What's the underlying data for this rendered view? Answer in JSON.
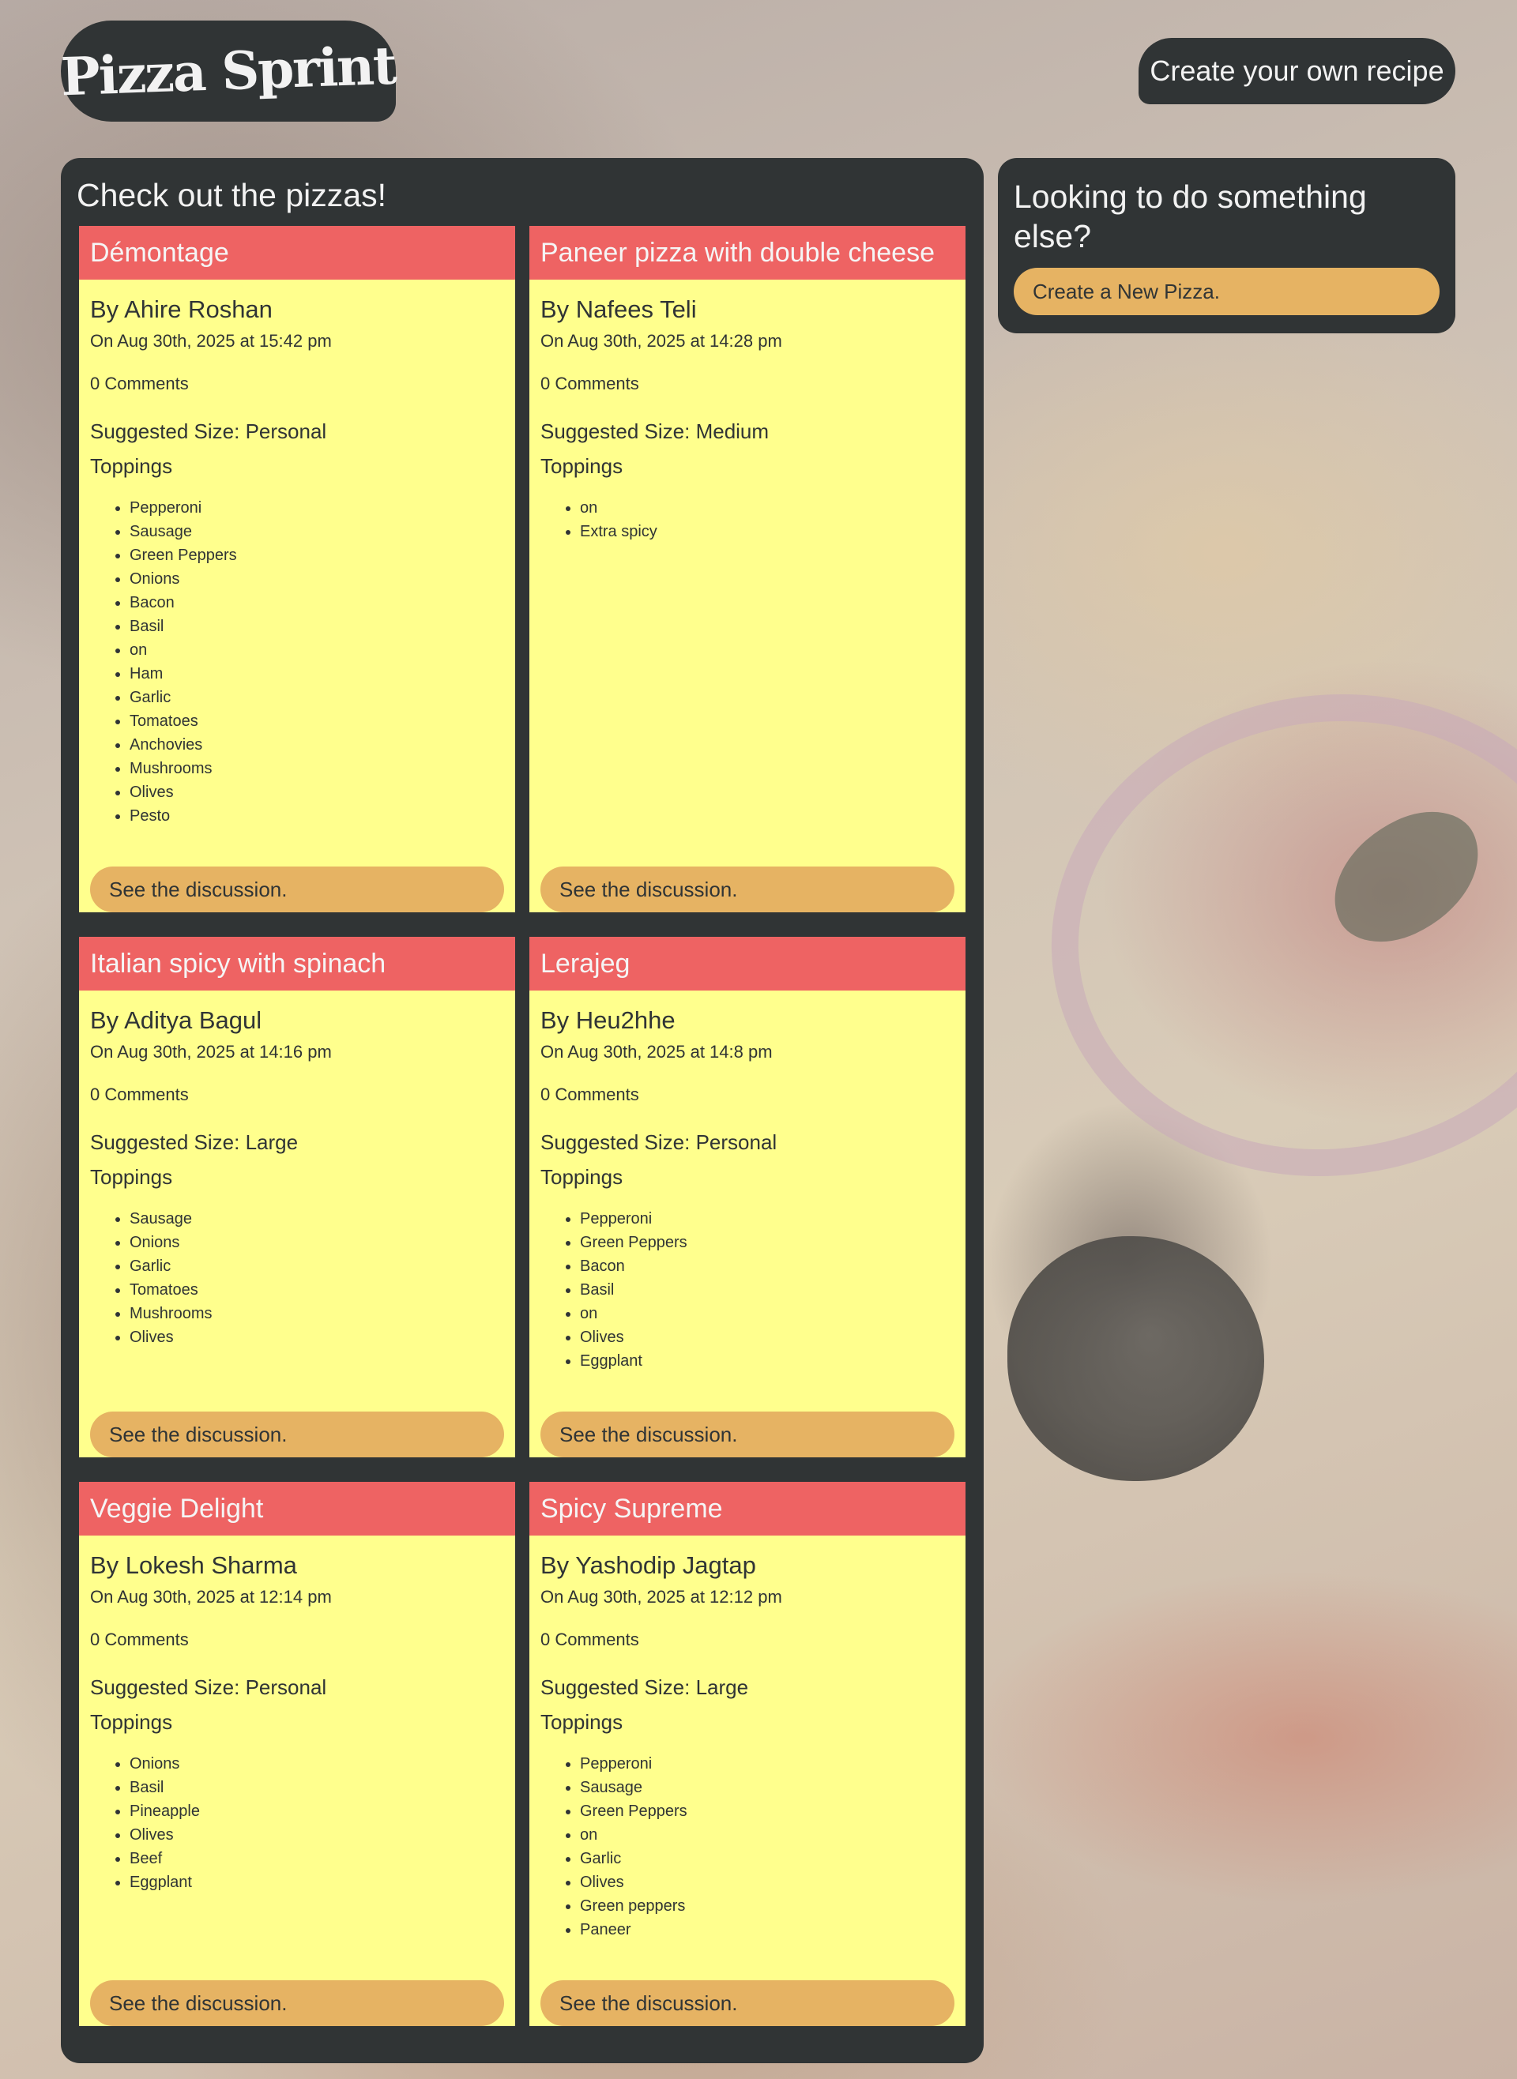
{
  "header": {
    "logo_text": "Pizza Sprint",
    "create_recipe_label": "Create your own recipe"
  },
  "main": {
    "title": "Check out the pizzas!",
    "discussion_label": "See the discussion.",
    "toppings_label": "Toppings",
    "pizzas": [
      {
        "name": "Démontage",
        "author": "By Ahire Roshan",
        "date": "On Aug 30th, 2025 at 15:42 pm",
        "comments": "0 Comments",
        "size": "Suggested Size: Personal",
        "toppings": [
          "Pepperoni",
          "Sausage",
          "Green Peppers",
          "Onions",
          "Bacon",
          "Basil",
          "on",
          "Ham",
          "Garlic",
          "Tomatoes",
          "Anchovies",
          "Mushrooms",
          "Olives",
          "Pesto"
        ]
      },
      {
        "name": "Paneer pizza with double cheese",
        "author": "By Nafees Teli",
        "date": "On Aug 30th, 2025 at 14:28 pm",
        "comments": "0 Comments",
        "size": "Suggested Size: Medium",
        "toppings": [
          "on",
          "Extra spicy"
        ]
      },
      {
        "name": "Italian spicy with spinach",
        "author": "By Aditya Bagul",
        "date": "On Aug 30th, 2025 at 14:16 pm",
        "comments": "0 Comments",
        "size": "Suggested Size: Large",
        "toppings": [
          "Sausage",
          "Onions",
          "Garlic",
          "Tomatoes",
          "Mushrooms",
          "Olives"
        ]
      },
      {
        "name": "Lerajeg",
        "author": "By Heu2hhe",
        "date": "On Aug 30th, 2025 at 14:8 pm",
        "comments": "0 Comments",
        "size": "Suggested Size: Personal",
        "toppings": [
          "Pepperoni",
          "Green Peppers",
          "Bacon",
          "Basil",
          "on",
          "Olives",
          "Eggplant"
        ]
      },
      {
        "name": "Veggie Delight",
        "author": "By Lokesh Sharma",
        "date": "On Aug 30th, 2025 at 12:14 pm",
        "comments": "0 Comments",
        "size": "Suggested Size: Personal",
        "toppings": [
          "Onions",
          "Basil",
          "Pineapple",
          "Olives",
          "Beef",
          "Eggplant"
        ]
      },
      {
        "name": "Spicy Supreme",
        "author": "By Yashodip Jagtap",
        "date": "On Aug 30th, 2025 at 12:12 pm",
        "comments": "0 Comments",
        "size": "Suggested Size: Large",
        "toppings": [
          "Pepperoni",
          "Sausage",
          "Green Peppers",
          "on",
          "Garlic",
          "Olives",
          "Green peppers",
          "Paneer"
        ]
      }
    ]
  },
  "sidebar": {
    "title": "Looking to do something else?",
    "new_pizza_label": "Create a New Pizza."
  },
  "colors": {
    "panel": "#303435",
    "card_header": "#ee6363",
    "card_body": "#ffff8d",
    "button": "#e6b363"
  }
}
